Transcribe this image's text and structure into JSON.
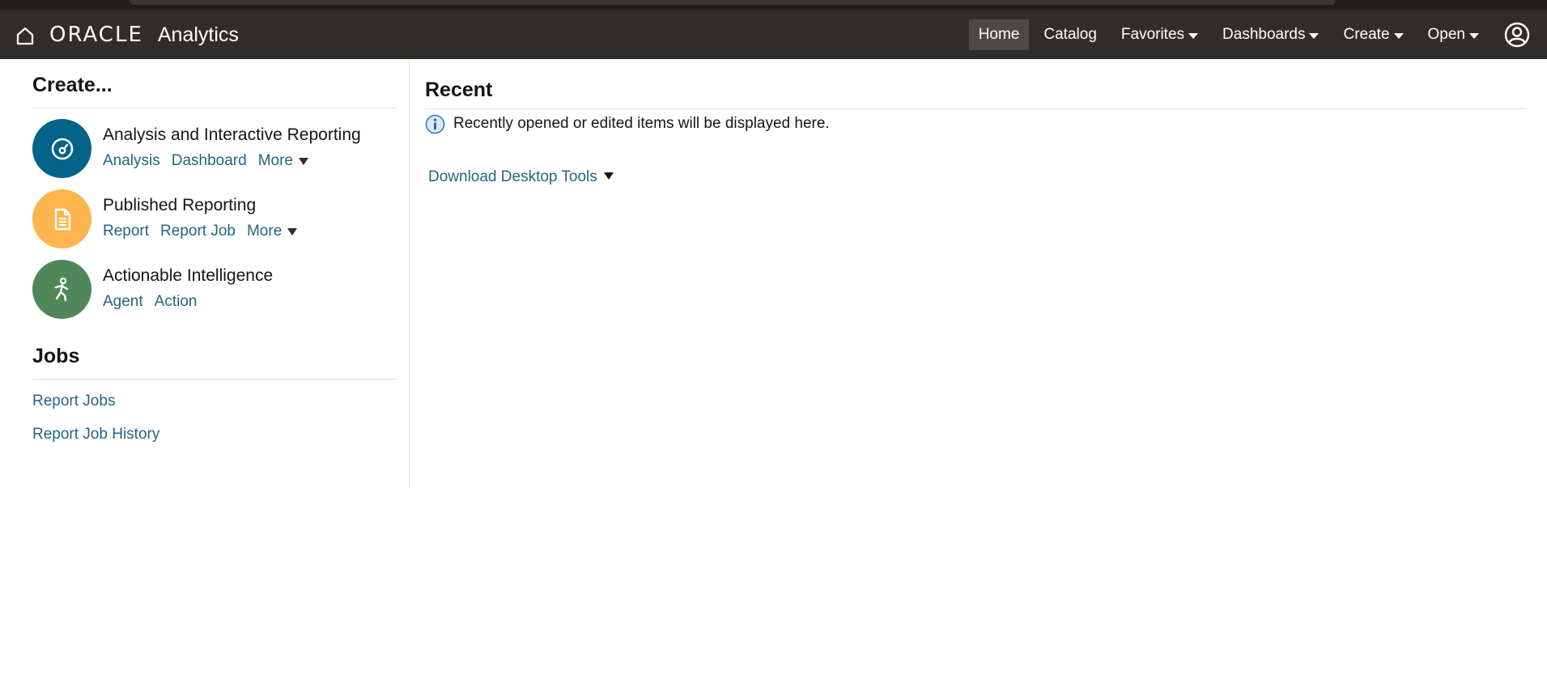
{
  "app": {
    "brand_logo": "ORACLE",
    "product_name": "Analytics"
  },
  "nav": {
    "items": [
      {
        "label": "Home",
        "active": true,
        "dropdown": false
      },
      {
        "label": "Catalog",
        "active": false,
        "dropdown": false
      },
      {
        "label": "Favorites",
        "active": false,
        "dropdown": true
      },
      {
        "label": "Dashboards",
        "active": false,
        "dropdown": true
      },
      {
        "label": "Create",
        "active": false,
        "dropdown": true
      },
      {
        "label": "Open",
        "active": false,
        "dropdown": true
      }
    ]
  },
  "create": {
    "title": "Create...",
    "rows": [
      {
        "title": "Analysis and Interactive Reporting",
        "links": [
          "Analysis",
          "Dashboard"
        ],
        "more": "More",
        "color": "#036389",
        "icon": "gauge-icon"
      },
      {
        "title": "Published Reporting",
        "links": [
          "Report",
          "Report Job"
        ],
        "more": "More",
        "color": "#ffb54d",
        "icon": "document-icon"
      },
      {
        "title": "Actionable Intelligence",
        "links": [
          "Agent",
          "Action"
        ],
        "more": null,
        "color": "#508759",
        "icon": "running-person-icon"
      }
    ]
  },
  "jobs": {
    "title": "Jobs",
    "links": [
      "Report Jobs",
      "Report Job History"
    ]
  },
  "recent": {
    "title": "Recent",
    "info_text": "Recently opened or edited items will be displayed here.",
    "download_label": "Download Desktop Tools"
  },
  "colors": {
    "header_bg": "#312d2a",
    "link": "#226587"
  }
}
